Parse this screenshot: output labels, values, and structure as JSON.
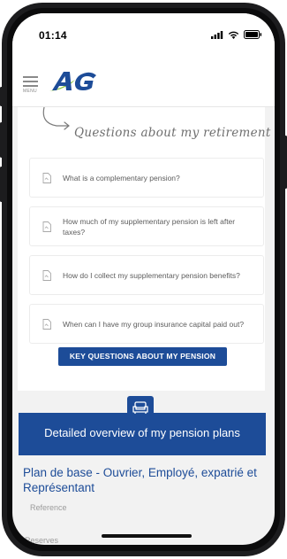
{
  "status": {
    "time": "01:14"
  },
  "header": {
    "menu_label": "MENU",
    "logo_alt": "AG"
  },
  "retirement": {
    "title": "Questions about my retirement",
    "questions": [
      "What is a complementary pension?",
      "How much of my supplementary pension is left after taxes?",
      "How do I collect my supplementary pension benefits?",
      "When can I have my group insurance capital paid out?"
    ],
    "cta_label": "KEY QUESTIONS ABOUT MY PENSION"
  },
  "overview": {
    "title": "Detailed overview of my pension plans",
    "plan_title": "Plan de base - Ouvrier, Employé, expatrié et Représentant",
    "reference_label": "Reference",
    "reserves_label": "Reserves"
  },
  "colors": {
    "brand_blue": "#1d4c98",
    "logo_green": "#8cc63e"
  }
}
